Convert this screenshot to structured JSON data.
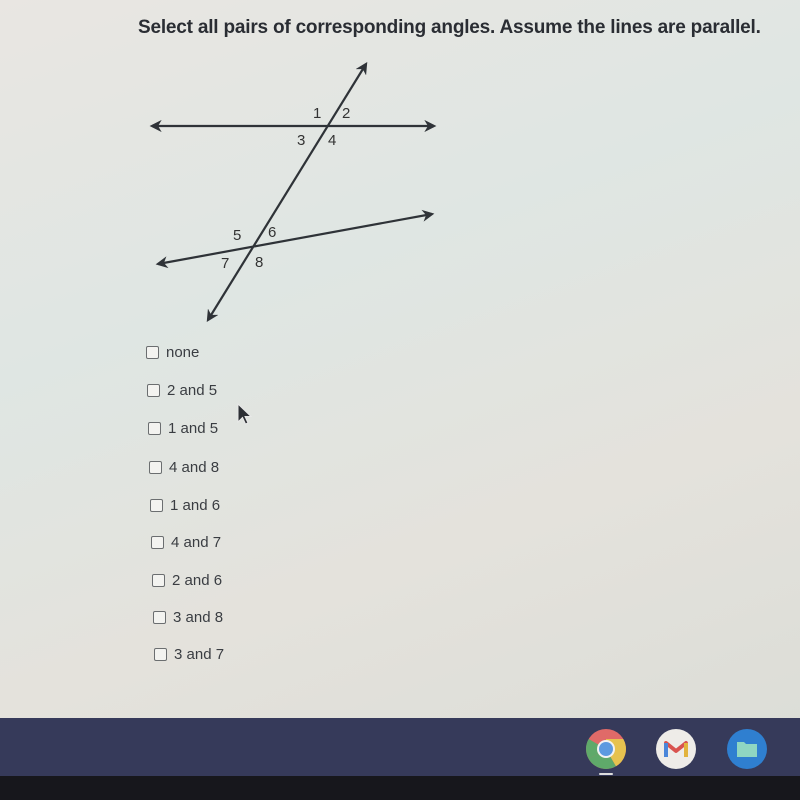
{
  "question": {
    "prompt": "Select all pairs of corresponding angles. Assume the lines are parallel."
  },
  "diagram": {
    "angle_labels": [
      "1",
      "2",
      "3",
      "4",
      "5",
      "6",
      "7",
      "8"
    ]
  },
  "options": [
    {
      "label": "none",
      "checked": false
    },
    {
      "label": "2 and 5",
      "checked": false
    },
    {
      "label": "1 and 5",
      "checked": false
    },
    {
      "label": "4 and 8",
      "checked": false
    },
    {
      "label": "1 and 6",
      "checked": false
    },
    {
      "label": "4 and 7",
      "checked": false
    },
    {
      "label": "2 and 6",
      "checked": false
    },
    {
      "label": "3 and 8",
      "checked": false
    },
    {
      "label": "3 and 7",
      "checked": false
    }
  ],
  "shelf": {
    "apps": [
      {
        "name": "Chrome",
        "icon": "chrome-icon",
        "running": true
      },
      {
        "name": "Gmail",
        "icon": "gmail-icon",
        "running": false
      },
      {
        "name": "Files",
        "icon": "files-icon",
        "running": false
      }
    ]
  }
}
